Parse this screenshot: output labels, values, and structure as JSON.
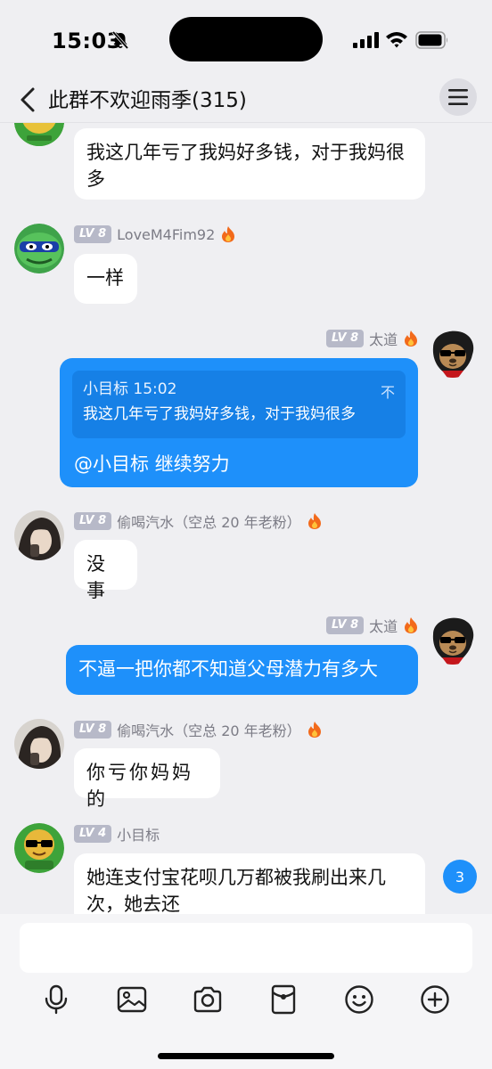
{
  "status_bar": {
    "time": "15:03"
  },
  "nav": {
    "title": "此群不欢迎雨季(315)"
  },
  "messages": [
    {
      "text": "我这几年亏了我妈好多钱，对于我妈很多"
    },
    {
      "level": "LV 8",
      "name": "LoveM4Fim92",
      "text": "一样"
    },
    {
      "level": "LV 8",
      "name": "太道",
      "quote_head": "小目标 15:02",
      "quote_text": "我这几年亏了我妈好多钱，对于我妈很多",
      "quote_close": "不",
      "text": "@小目标 继续努力"
    },
    {
      "level": "LV 8",
      "name": "偷喝汽水（空总 20 年老粉）",
      "text": "没事"
    },
    {
      "level": "LV 8",
      "name": "太道",
      "text": "不逼一把你都不知道父母潜力有多大"
    },
    {
      "level": "LV 8",
      "name": "偷喝汽水（空总 20 年老粉）",
      "text": "你亏你妈妈的"
    },
    {
      "level": "LV 4",
      "name": "小目标",
      "text": "她连支付宝花呗几万都被我刷出来几次，她去还"
    }
  ],
  "unread_count": "3",
  "input": {
    "placeholder": ""
  },
  "icons": [
    "mic-icon",
    "image-icon",
    "camera-icon",
    "red-packet-icon",
    "emoji-icon",
    "plus-icon"
  ],
  "colors": {
    "accent": "#1e90fa",
    "background": "#efeff2",
    "level_badge": "#b7b9c8"
  }
}
